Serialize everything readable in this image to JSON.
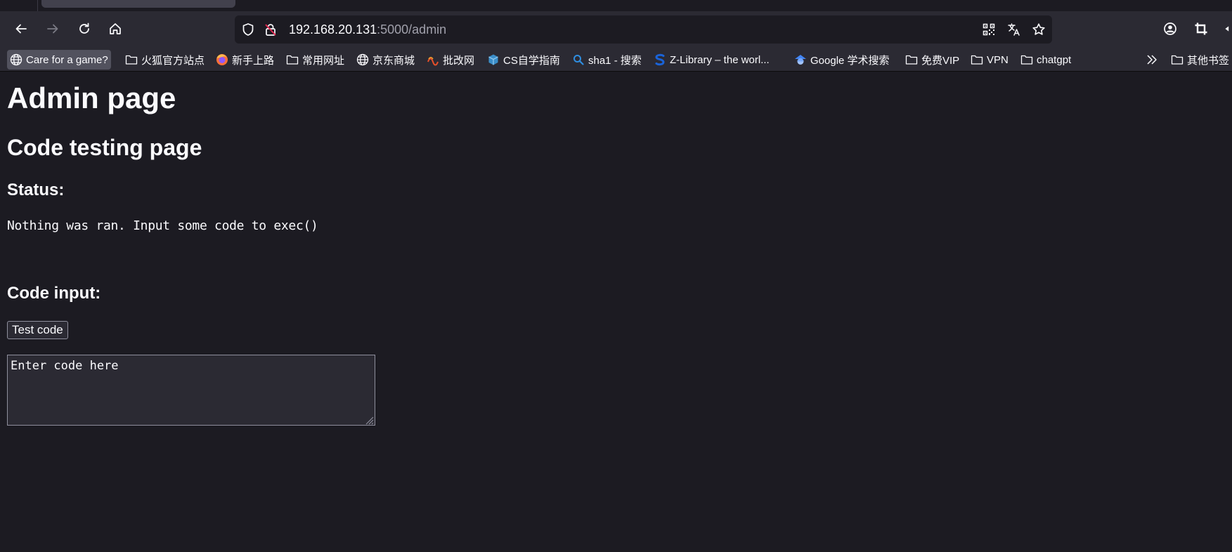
{
  "browser": {
    "url_host": "192.168.20.131",
    "url_path": ":5000/admin",
    "icons": [
      "back-icon",
      "forward-icon",
      "reload-icon",
      "home-icon",
      "shield-icon",
      "insecure-lock-icon",
      "qr-code-icon",
      "translate-icon",
      "star-icon",
      "account-icon",
      "crop-icon",
      "extension-icon"
    ]
  },
  "bookmarks": [
    {
      "label": "Care for a game?",
      "icon": "globe-icon"
    },
    {
      "label": "火狐官方站点",
      "icon": "folder-icon"
    },
    {
      "label": "新手上路",
      "icon": "firefox-icon"
    },
    {
      "label": "常用网址",
      "icon": "folder-icon"
    },
    {
      "label": "京东商城",
      "icon": "globe-icon"
    },
    {
      "label": "批改网",
      "icon": "pigai-icon"
    },
    {
      "label": "CS自学指南",
      "icon": "cube-icon"
    },
    {
      "label": "sha1 - 搜索",
      "icon": "search-icon"
    },
    {
      "label": "Z-Library – the worl...",
      "icon": "zlib-icon"
    },
    {
      "label": "Google 学术搜索",
      "icon": "scholar-icon"
    },
    {
      "label": "免费VIP",
      "icon": "folder-icon"
    },
    {
      "label": "VPN",
      "icon": "folder-icon"
    },
    {
      "label": "chatgpt",
      "icon": "folder-icon"
    },
    {
      "label": "其他书签",
      "icon": "folder-icon"
    }
  ],
  "page": {
    "title": "Admin page",
    "subtitle": "Code testing page",
    "status_heading": "Status:",
    "status_message": "Nothing was ran. Input some code to exec()",
    "code_heading": "Code input:",
    "test_button_label": "Test code",
    "code_placeholder": "Enter code here"
  },
  "colors": {
    "page_background": "#1c1b22",
    "toolbar_background": "#2b2a33",
    "text": "#fbfbfe",
    "insecure_red": "#e22850"
  }
}
